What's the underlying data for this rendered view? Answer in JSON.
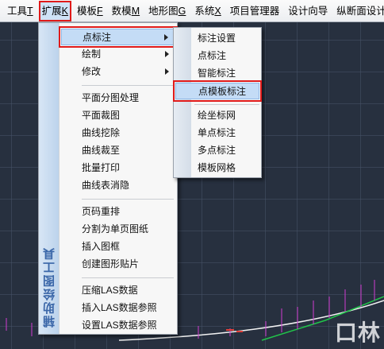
{
  "menubar": {
    "items": [
      {
        "label": "工具",
        "key": "T"
      },
      {
        "label": "扩展",
        "key": "K"
      },
      {
        "label": "模板",
        "key": "F"
      },
      {
        "label": "数模",
        "key": "M"
      },
      {
        "label": "地形图",
        "key": "G"
      },
      {
        "label": "系统",
        "key": "X"
      },
      {
        "label": "项目管理器"
      },
      {
        "label": "设计向导"
      },
      {
        "label": "纵断面设计"
      }
    ]
  },
  "dropdown": {
    "sidebar_title": "辅助绘图工具",
    "items": [
      {
        "label": "点标注",
        "submenu": true
      },
      {
        "label": "绘制",
        "submenu": true
      },
      {
        "label": "修改",
        "submenu": true
      },
      {
        "label": "平面分图处理"
      },
      {
        "label": "平面裁图"
      },
      {
        "label": "曲线挖除"
      },
      {
        "label": "曲线裁至"
      },
      {
        "label": "批量打印"
      },
      {
        "label": "曲线表消隐"
      },
      {
        "label": "页码重排"
      },
      {
        "label": "分割为单页图纸"
      },
      {
        "label": "插入图框"
      },
      {
        "label": "创建图形贴片"
      },
      {
        "label": "压缩LAS数据"
      },
      {
        "label": "插入LAS数据参照"
      },
      {
        "label": "设置LAS数据参照"
      }
    ]
  },
  "submenu": {
    "items": [
      {
        "label": "标注设置"
      },
      {
        "label": "点标注"
      },
      {
        "label": "智能标注"
      },
      {
        "label": "点模板标注"
      },
      {
        "label": "绘坐标网"
      },
      {
        "label": "单点标注"
      },
      {
        "label": "多点标注"
      },
      {
        "label": "模板网格"
      }
    ]
  },
  "watermark": "口林",
  "colors": {
    "highlight_outline": "#e01b1b",
    "menu_highlight": "#c4dcf6",
    "canvas_bg": "#27303f",
    "curve": "#ffffff",
    "green_line": "#21c44a",
    "magenta_marks": "#d03cd0"
  }
}
